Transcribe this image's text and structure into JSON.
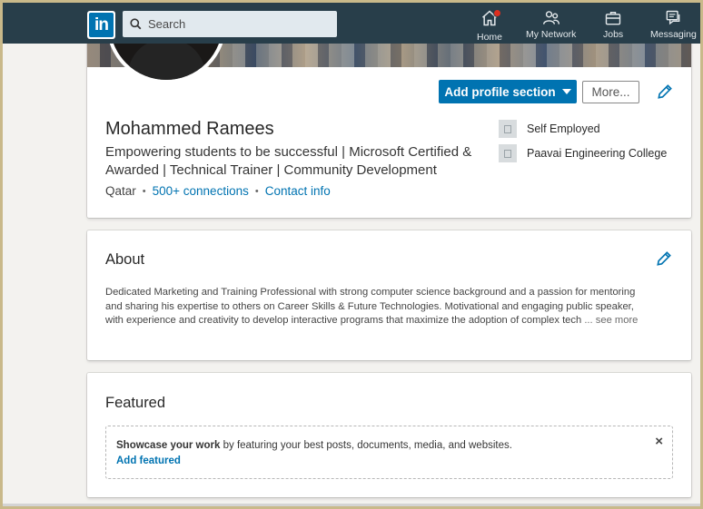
{
  "nav": {
    "logo": "in",
    "search_placeholder": "Search",
    "items": [
      {
        "label": "Home",
        "icon": "home-icon",
        "has_badge": true
      },
      {
        "label": "My Network",
        "icon": "network-icon"
      },
      {
        "label": "Jobs",
        "icon": "briefcase-icon"
      },
      {
        "label": "Messaging",
        "icon": "messaging-icon"
      }
    ]
  },
  "profile": {
    "name": "Mohammed Ramees",
    "headline": "Empowering students to be successful | Microsoft Certified & Awarded | Technical Trainer | Community Development",
    "location": "Qatar",
    "connections": "500+ connections",
    "contact": "Contact info",
    "add_section_label": "Add profile section",
    "more_label": "More...",
    "experience": [
      {
        "label": "Self Employed"
      },
      {
        "label": "Paavai Engineering College"
      }
    ]
  },
  "about": {
    "title": "About",
    "line1": "Dedicated Marketing and Training Professional with strong computer science background and a passion for mentoring",
    "line2": "and sharing his expertise to others on Career Skills & Future Technologies. Motivational and engaging public speaker,",
    "line3": "with experience and creativity to develop interactive programs that maximize the adoption of complex tech",
    "see_more": "... see more"
  },
  "featured": {
    "title": "Featured",
    "bold": "Showcase your work",
    "text": " by featuring your best posts, documents, media, and websites.",
    "link": "Add featured",
    "close": "×"
  },
  "colors": {
    "nav_bg": "#283e4a",
    "accent": "#0073b1",
    "page_bg": "#f3f2ef"
  }
}
